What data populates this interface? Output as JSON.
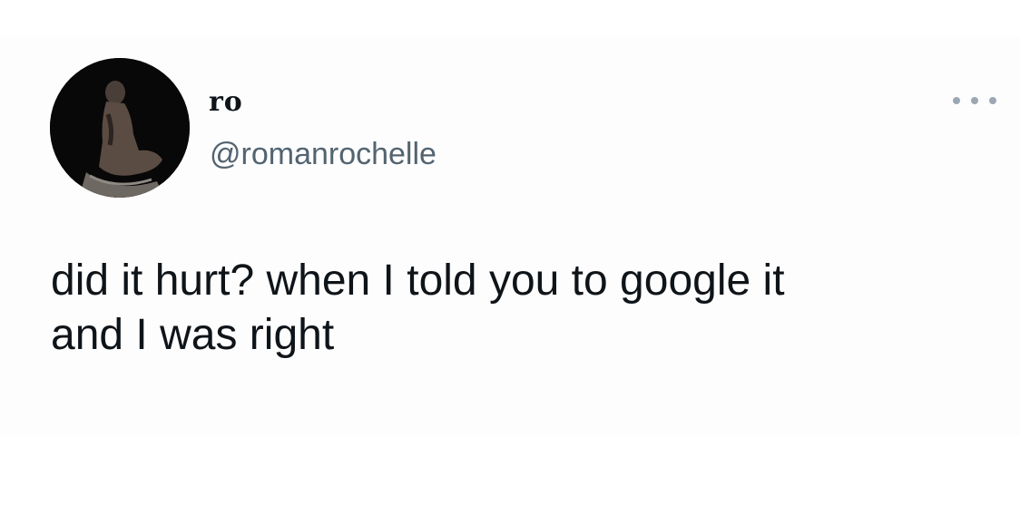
{
  "tweet": {
    "author": {
      "display_name": "ro",
      "handle": "@romanrochelle"
    },
    "text_line_1": "did it hurt? when I told you to google it",
    "text_line_2": "and I was right",
    "actions": {
      "more_icon": "more-horizontal-icon"
    }
  }
}
